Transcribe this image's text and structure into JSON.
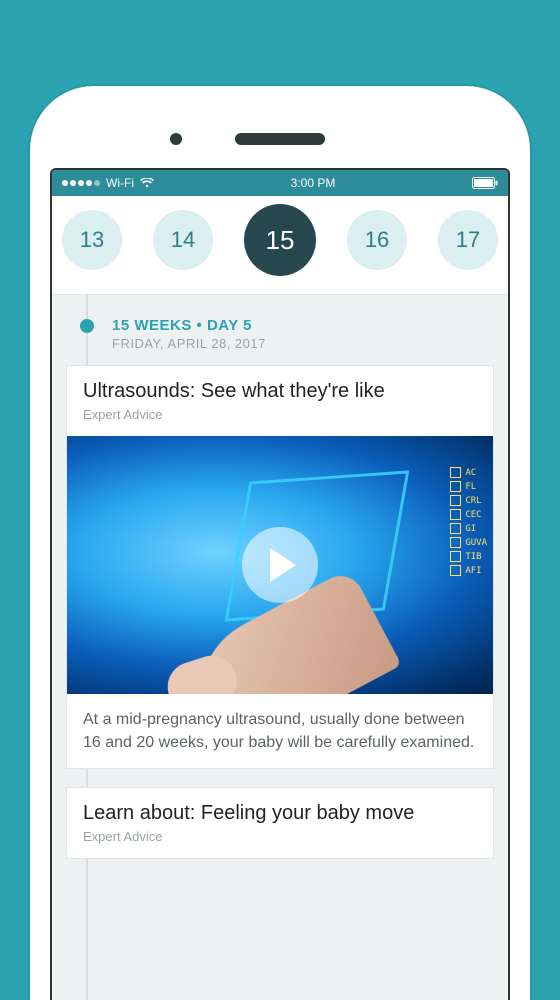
{
  "status": {
    "carrier": "Wi-Fi",
    "time": "3:00 PM"
  },
  "weeks": {
    "items": [
      "13",
      "14",
      "15",
      "16",
      "17"
    ],
    "active_index": 2
  },
  "dateline": {
    "main": "15 WEEKS • DAY 5",
    "sub": "FRIDAY, APRIL 28, 2017"
  },
  "cards": [
    {
      "title": "Ultrasounds: See what they're like",
      "tag": "Expert Advice",
      "desc": "At a mid-pregnancy ultrasound, usually done between 16 and 20 weeks, your baby will be carefully examined.",
      "video_labels": [
        "AC",
        "FL",
        "CRL",
        "CEC",
        "GI",
        "GUVA",
        "TIB",
        "AFI"
      ]
    },
    {
      "title": "Learn about: Feeling your baby move",
      "tag": "Expert Advice"
    }
  ]
}
